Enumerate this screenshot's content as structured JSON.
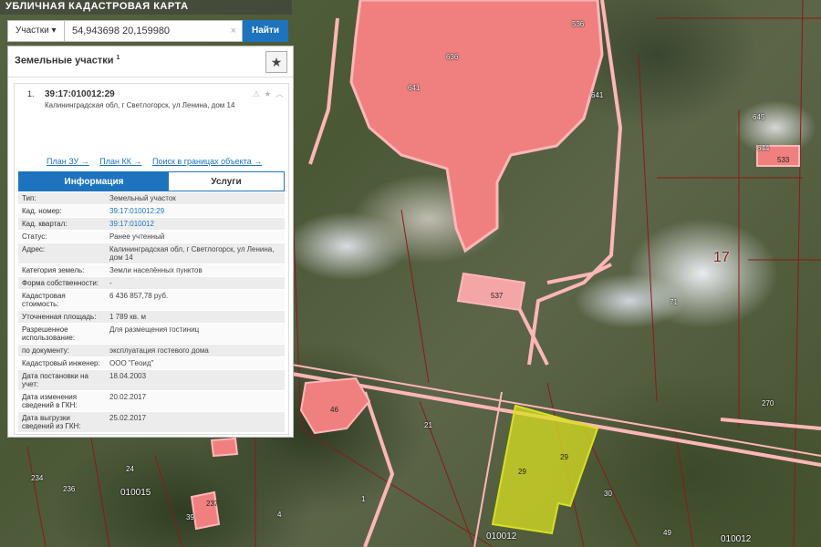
{
  "map": {
    "title": "УБЛИЧНАЯ КАДАСТРОВАЯ КАРТА",
    "labels": [
      "636",
      "536",
      "641",
      "641",
      "645",
      "644",
      "533",
      "537",
      "17",
      "71",
      "270",
      "46",
      "21",
      "29",
      "29",
      "30",
      "24",
      "234",
      "236",
      "39",
      "237",
      "4",
      "1",
      "49",
      "010015",
      "010012",
      "010012"
    ]
  },
  "search": {
    "mode": "Участки",
    "query": "54,943698 20,159980",
    "clear": "×",
    "button": "Найти"
  },
  "panel": {
    "title": "Земельные участки",
    "count_sup": "1",
    "star": "★",
    "card": {
      "num": "1.",
      "cadastral": "39:17:010012:29",
      "icons": "⚠ ★ ︿",
      "address": "Калининградская обл, г Светлогорск, ул Ленина, дом 14",
      "links": [
        "План ЗУ →",
        "План КК →",
        "Поиск в границах объекта →"
      ],
      "tabs": {
        "info": "Информация",
        "services": "Услуги"
      },
      "rows": [
        {
          "k": "Тип:",
          "v": "Земельный участок"
        },
        {
          "k": "Кад. номер:",
          "v": "39:17:010012:29"
        },
        {
          "k": "Кад. квартал:",
          "v": "39:17:010012"
        },
        {
          "k": "Статус:",
          "v": "Ранее учтенный"
        },
        {
          "k": "Адрес:",
          "v": "Калининградская обл, г Светлогорск, ул Ленина, дом 14"
        },
        {
          "k": "Категория земель:",
          "v": "Земли населённых пунктов"
        },
        {
          "k": "Форма собственности:",
          "v": "-"
        },
        {
          "k": "Кадастровая стоимость:",
          "v": "6 436 857,78 руб."
        },
        {
          "k": "Уточненная площадь:",
          "v": "1 789 кв. м"
        },
        {
          "k": "Разрешенное использование:",
          "v": "Для размещения гостиниц"
        },
        {
          "k": "по документу:",
          "v": "эксплуатация гостевого дома"
        },
        {
          "k": "Кадастровый инженер:",
          "v": "ООО \"Геоид\""
        },
        {
          "k": "Дата постановки на учет:",
          "v": "18.04.2003"
        },
        {
          "k": "Дата изменения сведений в ГКН:",
          "v": "20.02.2017"
        },
        {
          "k": "Дата выгрузки сведений из ГКН:",
          "v": "25.02.2017"
        }
      ]
    }
  },
  "colors": {
    "accent": "#1e73be",
    "parcel_fill": "#f08080",
    "parcel_border": "#ffb6b6",
    "selected": "#d9e021",
    "boundary": "#8b1a1a"
  }
}
